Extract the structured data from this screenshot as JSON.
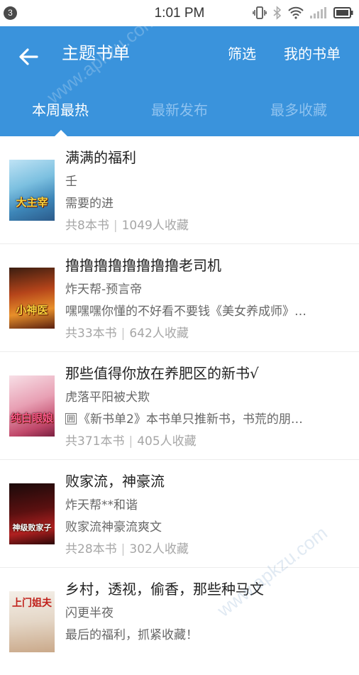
{
  "status_bar": {
    "badge": "3",
    "time": "1:01 PM"
  },
  "header": {
    "title": "主题书单",
    "filter_label": "筛选",
    "my_lists_label": "我的书单",
    "accent_color": "#3a93dc"
  },
  "tabs": [
    {
      "label": "本周最热",
      "active": true
    },
    {
      "label": "最新发布",
      "active": false
    },
    {
      "label": "最多收藏",
      "active": false
    }
  ],
  "books": [
    {
      "title": "满满的福利",
      "author": "壬",
      "desc": "需要的进",
      "count": "共8本书",
      "fav": "1049人收藏",
      "cover_text": "大主宰"
    },
    {
      "title": "撸撸撸撸撸撸撸撸老司机",
      "author": "炸天帮-预言帝",
      "desc": "嘿嘿嘿你懂的不好看不要钱《美女养成师》…",
      "count": "共33本书",
      "fav": "642人收藏",
      "cover_text": "小神医"
    },
    {
      "title": "那些值得你放在养肥区的新书√",
      "author": "虎落平阳被犬欺",
      "tag": "囲",
      "desc": "《新书单2》本书单只推新书，书荒的朋…",
      "count": "共371本书",
      "fav": "405人收藏",
      "cover_text": "纯白眼娘"
    },
    {
      "title": "败家流，神豪流",
      "author": "炸天帮**和谐",
      "desc": "败家流神豪流爽文",
      "count": "共28本书",
      "fav": "302人收藏",
      "cover_text": "神级败家子"
    },
    {
      "title": "乡村，透视，偷香，那些种马文",
      "author": "闪更半夜",
      "desc": "最后的福利，抓紧收藏！",
      "count": "",
      "fav": "",
      "cover_text": "上门姐夫"
    }
  ],
  "watermark": "www.apkzu.com"
}
